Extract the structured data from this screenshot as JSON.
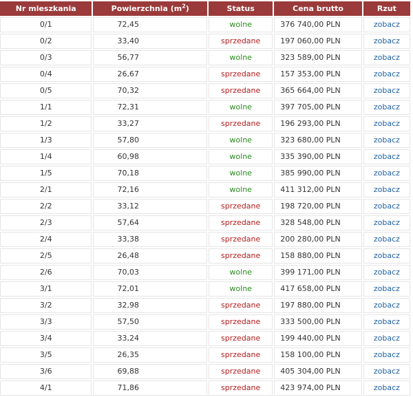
{
  "table": {
    "headers": {
      "number": "Nr mieszkania",
      "area": "Powierzchnia (m",
      "area_sup": "2",
      "area_close": ")",
      "status": "Status",
      "price": "Cena brutto",
      "plan": "Rzut"
    },
    "status_colors": {
      "wolne": "#2b8a1f",
      "sprzedane": "#b31b1b"
    },
    "header_color": "#9b3a3a",
    "link_color": "#1f5fa0",
    "rows": [
      {
        "number": "0/1",
        "area": "72,45",
        "status": "wolne",
        "price": "376 740,00 PLN",
        "plan": "zobacz"
      },
      {
        "number": "0/2",
        "area": "33,40",
        "status": "sprzedane",
        "price": "197 060,00 PLN",
        "plan": "zobacz"
      },
      {
        "number": "0/3",
        "area": "56,77",
        "status": "wolne",
        "price": "323 589,00 PLN",
        "plan": "zobacz"
      },
      {
        "number": "0/4",
        "area": "26,67",
        "status": "sprzedane",
        "price": "157 353,00 PLN",
        "plan": "zobacz"
      },
      {
        "number": "0/5",
        "area": "70,32",
        "status": "sprzedane",
        "price": "365 664,00 PLN",
        "plan": "zobacz"
      },
      {
        "number": "1/1",
        "area": "72,31",
        "status": "wolne",
        "price": "397 705,00 PLN",
        "plan": "zobacz"
      },
      {
        "number": "1/2",
        "area": "33,27",
        "status": "sprzedane",
        "price": "196 293,00 PLN",
        "plan": "zobacz"
      },
      {
        "number": "1/3",
        "area": "57,80",
        "status": "wolne",
        "price": "323 680,00 PLN",
        "plan": "zobacz"
      },
      {
        "number": "1/4",
        "area": "60,98",
        "status": "wolne",
        "price": "335 390,00 PLN",
        "plan": "zobacz"
      },
      {
        "number": "1/5",
        "area": "70,18",
        "status": "wolne",
        "price": "385 990,00 PLN",
        "plan": "zobacz"
      },
      {
        "number": "2/1",
        "area": "72,16",
        "status": "wolne",
        "price": "411 312,00 PLN",
        "plan": "zobacz"
      },
      {
        "number": "2/2",
        "area": "33,12",
        "status": "sprzedane",
        "price": "198 720,00 PLN",
        "plan": "zobacz"
      },
      {
        "number": "2/3",
        "area": "57,64",
        "status": "sprzedane",
        "price": "328 548,00 PLN",
        "plan": "zobacz"
      },
      {
        "number": "2/4",
        "area": "33,38",
        "status": "sprzedane",
        "price": "200 280,00 PLN",
        "plan": "zobacz"
      },
      {
        "number": "2/5",
        "area": "26,48",
        "status": "sprzedane",
        "price": "158 880,00 PLN",
        "plan": "zobacz"
      },
      {
        "number": "2/6",
        "area": "70,03",
        "status": "wolne",
        "price": "399 171,00 PLN",
        "plan": "zobacz"
      },
      {
        "number": "3/1",
        "area": "72,01",
        "status": "wolne",
        "price": "417 658,00 PLN",
        "plan": "zobacz"
      },
      {
        "number": "3/2",
        "area": "32,98",
        "status": "sprzedane",
        "price": "197 880,00 PLN",
        "plan": "zobacz"
      },
      {
        "number": "3/3",
        "area": "57,50",
        "status": "sprzedane",
        "price": "333 500,00 PLN",
        "plan": "zobacz"
      },
      {
        "number": "3/4",
        "area": "33,24",
        "status": "sprzedane",
        "price": "199 440,00 PLN",
        "plan": "zobacz"
      },
      {
        "number": "3/5",
        "area": "26,35",
        "status": "sprzedane",
        "price": "158 100,00 PLN",
        "plan": "zobacz"
      },
      {
        "number": "3/6",
        "area": "69,88",
        "status": "sprzedane",
        "price": "405 304,00 PLN",
        "plan": "zobacz"
      },
      {
        "number": "4/1",
        "area": "71,86",
        "status": "sprzedane",
        "price": "423 974,00 PLN",
        "plan": "zobacz"
      }
    ]
  }
}
